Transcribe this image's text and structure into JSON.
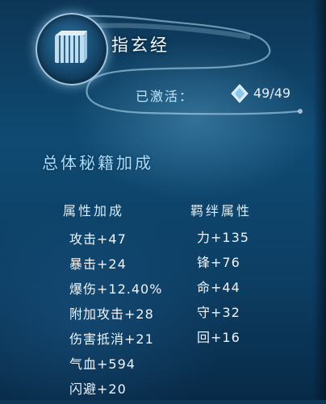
{
  "header": {
    "title": "指玄经",
    "activated_label": "已激活：",
    "activated_count": "49/49",
    "tome_icon": "scroll-book-icon",
    "gem_icon": "diamond-gem-icon"
  },
  "bonus_section": {
    "title": "总体秘籍加成",
    "attributes": {
      "header": "属性加成",
      "items": [
        "攻击+47",
        "暴击+24",
        "爆伤+12.40%",
        "附加攻击+28",
        "伤害抵消+21",
        "气血+594",
        "闪避+20"
      ]
    },
    "bonds": {
      "header": "羁绊属性",
      "items": [
        "力+135",
        "锋+76",
        "命+44",
        "守+32",
        "回+16"
      ]
    }
  },
  "colors": {
    "background": "#0f4a72",
    "accent_blue": "#a6dcff",
    "text": "#f0f4f8"
  }
}
